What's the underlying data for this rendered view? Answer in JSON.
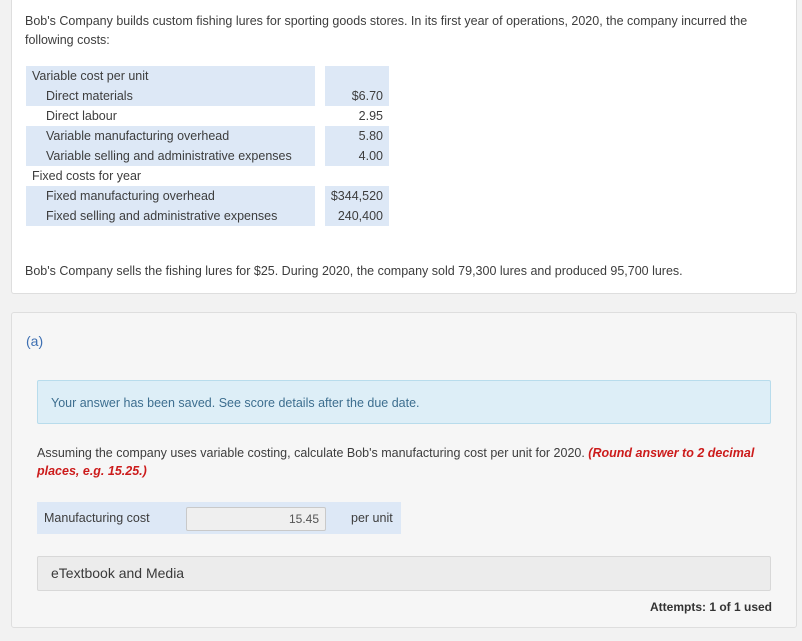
{
  "problem": {
    "intro": "Bob's Company builds custom fishing lures for sporting goods stores. In its first year of operations, 2020, the company incurred the following costs:",
    "table": {
      "variable_header": "Variable cost per unit",
      "variable_rows": [
        {
          "label": "Direct materials",
          "value": "$6.70"
        },
        {
          "label": "Direct labour",
          "value": "2.95"
        },
        {
          "label": "Variable manufacturing overhead",
          "value": "5.80"
        },
        {
          "label": "Variable selling and administrative expenses",
          "value": "4.00"
        }
      ],
      "fixed_header": "Fixed costs for year",
      "fixed_rows": [
        {
          "label": "Fixed manufacturing overhead",
          "value": "$344,520"
        },
        {
          "label": "Fixed selling and administrative expenses",
          "value": "240,400"
        }
      ]
    },
    "outro": "Bob's Company sells the fishing lures for $25. During 2020, the company sold 79,300 lures and produced 95,700 lures."
  },
  "part": {
    "label": "(a)",
    "notice": "Your answer has been saved. See score details after the due date.",
    "question": "Assuming the company uses variable costing, calculate Bob's manufacturing cost per unit for 2020. ",
    "hint": "(Round answer to 2 decimal places, e.g. 15.25.)",
    "answer": {
      "label": "Manufacturing cost",
      "value": "15.45",
      "unit": "per unit"
    },
    "ebook_label": "eTextbook and Media",
    "attempts": "Attempts: 1 of 1 used"
  }
}
